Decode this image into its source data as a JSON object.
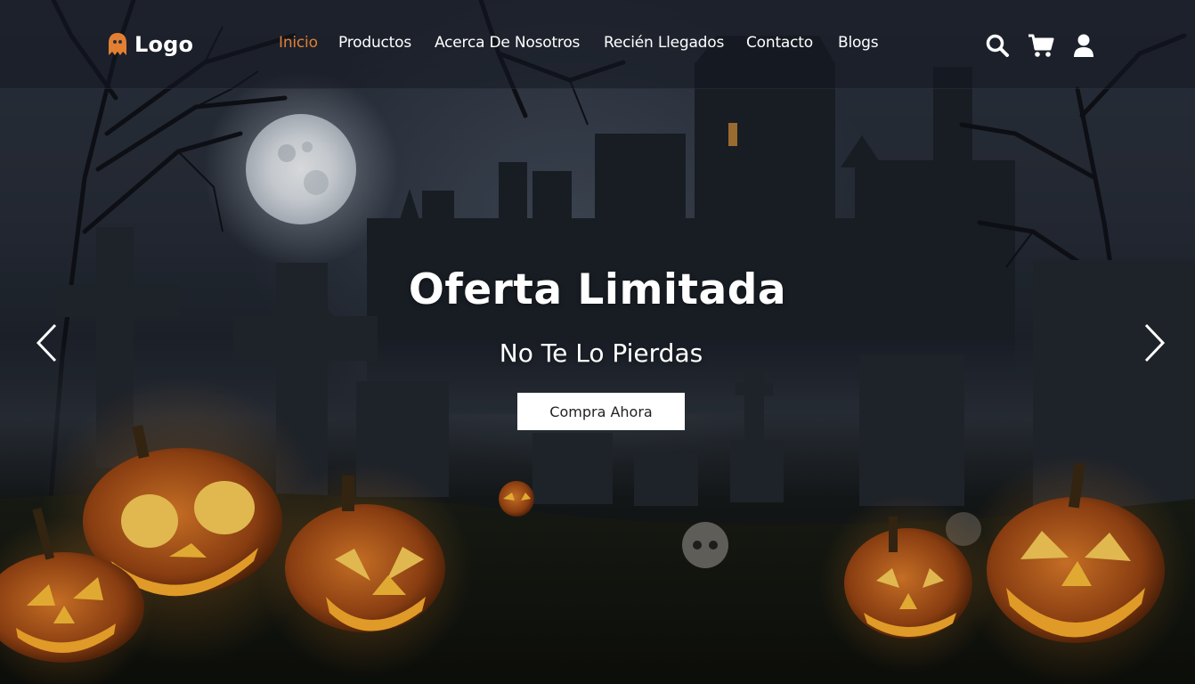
{
  "brand": {
    "name": "Logo",
    "accent": "#e37f33"
  },
  "nav": {
    "items": [
      {
        "label": "Inicio",
        "active": true
      },
      {
        "label": "Productos",
        "active": false
      },
      {
        "label": "Acerca De Nosotros",
        "active": false
      },
      {
        "label": "Recién Llegados",
        "active": false
      },
      {
        "label": "Contacto",
        "active": false
      },
      {
        "label": "Blogs",
        "active": false
      }
    ]
  },
  "header_icons": [
    "search-icon",
    "cart-icon",
    "user-icon"
  ],
  "hero": {
    "title": "Oferta Limitada",
    "subtitle": "No Te Lo Pierdas",
    "cta_label": "Compra Ahora",
    "background": "halloween-graveyard-scene"
  },
  "carousel": {
    "prev": "chevron-left-icon",
    "next": "chevron-right-icon"
  },
  "colors": {
    "nav_text": "#ffffff",
    "nav_active": "#e37f33",
    "cta_bg": "#ffffff",
    "cta_text": "#222222"
  }
}
